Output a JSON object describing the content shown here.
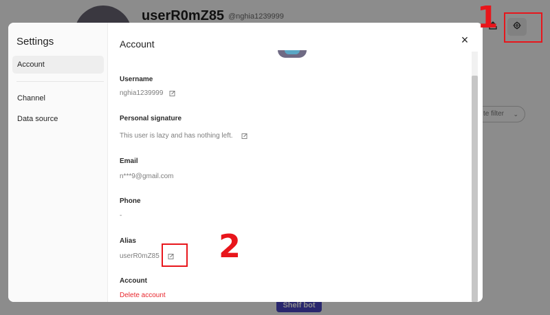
{
  "background": {
    "username": "userR0mZ85",
    "handle": "@nghia1239999",
    "filter_label": "te filter",
    "shelf_button": "Shelf bot"
  },
  "annotations": {
    "step1": "1",
    "step2": "2"
  },
  "settings": {
    "title": "Settings",
    "nav": [
      {
        "label": "Account",
        "active": true
      },
      {
        "label": "Channel",
        "active": false
      },
      {
        "label": "Data source",
        "active": false
      }
    ]
  },
  "account": {
    "title": "Account",
    "close_icon": "close-icon",
    "fields": {
      "username": {
        "label": "Username",
        "value": "nghia1239999"
      },
      "signature": {
        "label": "Personal signature",
        "value": "This user is lazy and has nothing left."
      },
      "email": {
        "label": "Email",
        "value": "n***9@gmail.com"
      },
      "phone": {
        "label": "Phone",
        "value": "-"
      },
      "alias": {
        "label": "Alias",
        "value": "userR0mZ85"
      },
      "account": {
        "label": "Account",
        "action": "Delete account"
      }
    }
  },
  "colors": {
    "annotation": "#e8151b",
    "danger": "#e8252b",
    "brand": "#4c47c9"
  }
}
